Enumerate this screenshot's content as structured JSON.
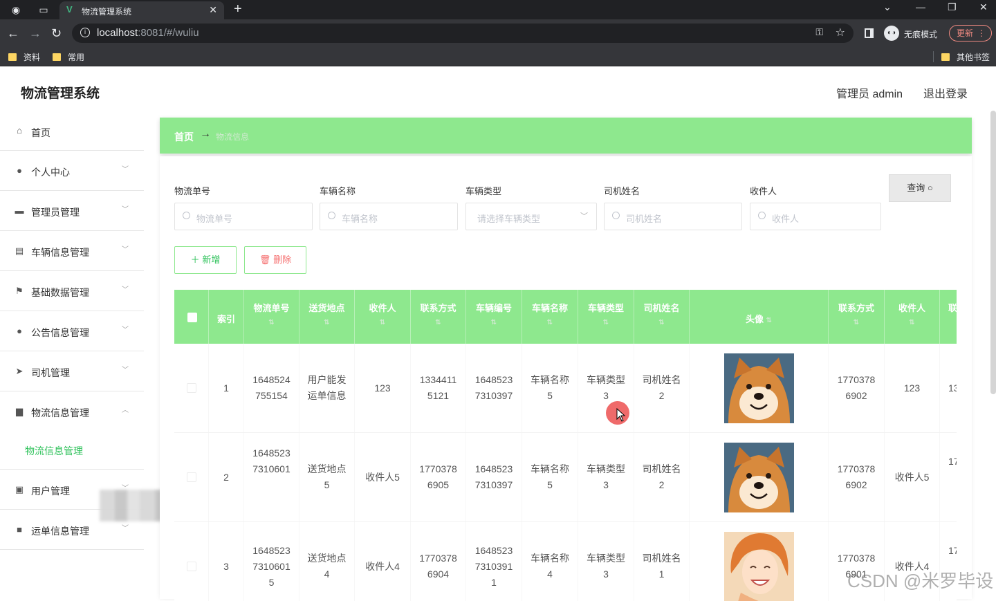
{
  "browser": {
    "tab_title": "物流管理系统",
    "url_host": "localhost",
    "url_rest": ":8081/#/wuliu",
    "incognito_label": "无痕模式",
    "update_label": "更新",
    "bookmarks": [
      "资料",
      "常用"
    ],
    "other_bookmarks": "其他书签"
  },
  "app": {
    "title": "物流管理系统",
    "user_label": "管理员 admin",
    "logout_label": "退出登录"
  },
  "sidebar": {
    "items": [
      {
        "label": "首页",
        "icon": "home-icon"
      },
      {
        "label": "个人中心",
        "icon": "user-icon"
      },
      {
        "label": "管理员管理",
        "icon": "briefcase-icon"
      },
      {
        "label": "车辆信息管理",
        "icon": "chat-icon"
      },
      {
        "label": "基础数据管理",
        "icon": "flag-icon"
      },
      {
        "label": "公告信息管理",
        "icon": "bulb-icon"
      },
      {
        "label": "司机管理",
        "icon": "send-icon"
      },
      {
        "label": "物流信息管理",
        "icon": "monitor-icon"
      },
      {
        "label": "用户管理",
        "icon": "image-icon"
      },
      {
        "label": "运单信息管理",
        "icon": "video-icon"
      }
    ],
    "submenu": "物流信息管理"
  },
  "breadcrumb": {
    "home": "首页",
    "current": "物流信息"
  },
  "filters": {
    "labels": [
      "物流单号",
      "车辆名称",
      "车辆类型",
      "司机姓名",
      "收件人"
    ],
    "placeholders": [
      "物流单号",
      "车辆名称",
      "请选择车辆类型",
      "司机姓名",
      "收件人"
    ],
    "query_button": "查询"
  },
  "actions": {
    "add": "新增",
    "delete": "删除"
  },
  "table": {
    "headers": [
      "索引",
      "物流单号",
      "送货地点",
      "收件人",
      "联系方式",
      "车辆编号",
      "车辆名称",
      "车辆类型",
      "司机姓名",
      "头像",
      "联系方式",
      "收件人",
      "联"
    ],
    "rows": [
      [
        "1",
        "1648524\n755154",
        "用户能发\n运单信息",
        "123",
        "1334411\n5121",
        "1648523\n7310397",
        "车辆名称\n5",
        "车辆类型\n3",
        "司机姓名\n2",
        "dog",
        "1770378\n6902",
        "123",
        "13"
      ],
      [
        "2",
        "1648523\n7310601",
        "送货地点\n5",
        "收件人5",
        "1770378\n6905",
        "1648523\n7310397",
        "车辆名称\n5",
        "车辆类型\n3",
        "司机姓名\n2",
        "dog",
        "1770378\n6902",
        "收件人5",
        "17"
      ],
      [
        "3",
        "1648523\n7310601\n5",
        "送货地点\n4",
        "收件人4",
        "1770378\n6904",
        "1648523\n7310391\n1",
        "车辆名称\n4",
        "车辆类型\n3",
        "司机姓名\n1",
        "girl",
        "1770378\n6901",
        "收件人4",
        "17"
      ]
    ]
  },
  "watermark": "CSDN @米罗毕设",
  "colors": {
    "accent": "#8ee88e",
    "success": "#2fc25b",
    "danger": "#f56c6c"
  }
}
